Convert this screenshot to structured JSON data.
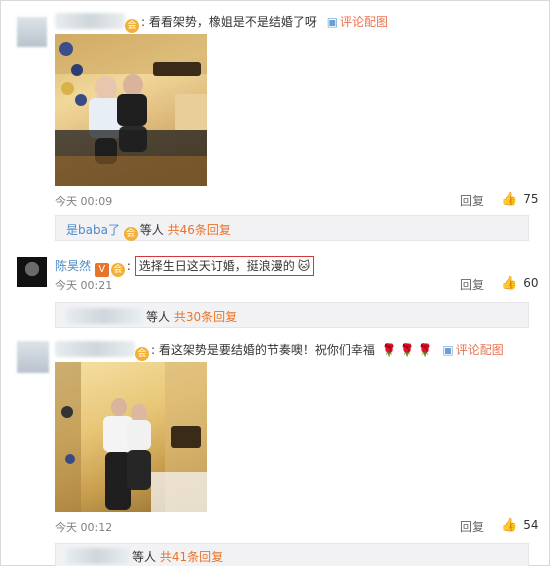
{
  "comments": [
    {
      "text": "看看架势，橡姐是不是结婚了呀",
      "pic_link": "评论配图",
      "time": "今天 00:09",
      "reply": "回复",
      "likes": "75",
      "sub": {
        "name": "是baba了",
        "mid": "等人",
        "count": "共46条回复"
      }
    },
    {
      "author": "陈昊然",
      "text": "选择生日这天订婚，挺浪漫的",
      "time": "今天 00:21",
      "reply": "回复",
      "likes": "60",
      "sub": {
        "mid": "等人",
        "count": "共30条回复"
      }
    },
    {
      "text": "看这架势是要结婚的节奏噢！祝你们幸福",
      "pic_link": "评论配图",
      "time": "今天 00:12",
      "reply": "回复",
      "likes": "54",
      "sub": {
        "mid": "等人",
        "count": "共41条回复"
      }
    }
  ],
  "colors": {
    "link": "#eb7350",
    "sub_name": "#4a8bc6",
    "count": "#e8742a",
    "highlight_box": "#d23a3a"
  },
  "icons": [
    "vip-icon",
    "image-icon",
    "thumb-up-icon",
    "emoji-icon",
    "rose-icon",
    "v-badge-icon"
  ]
}
